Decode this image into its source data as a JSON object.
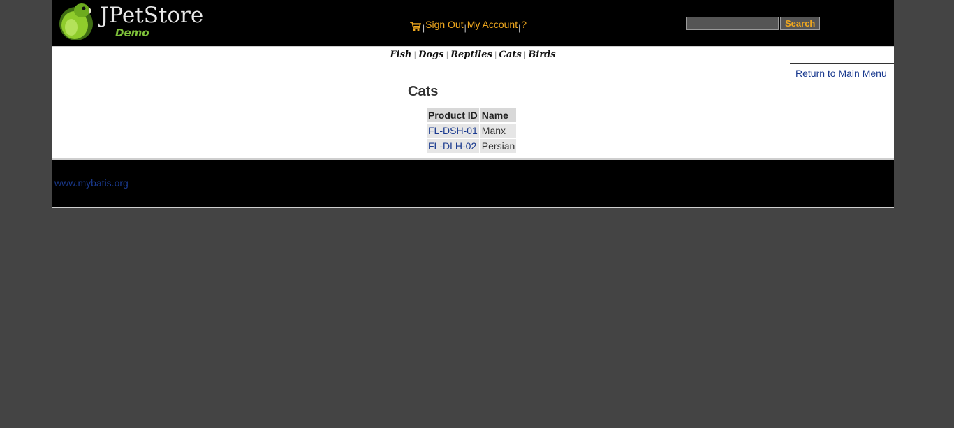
{
  "header": {
    "logo": {
      "title": "JPetStore",
      "subtitle": "Demo"
    },
    "menu": {
      "cart_icon": "shopping-cart-icon",
      "sign_out": "Sign Out",
      "my_account": "My Account",
      "help": "?",
      "separator": "|"
    },
    "search": {
      "value": "",
      "button_label": "Search"
    },
    "colors": {
      "background": "#000000",
      "link": "#f0a81e",
      "page_background": "#444444"
    }
  },
  "quicklinks": [
    "Fish",
    "Dogs",
    "Reptiles",
    "Cats",
    "Birds"
  ],
  "back_link": "Return to Main Menu",
  "category": {
    "title": "Cats",
    "columns": [
      "Product ID",
      "Name"
    ],
    "rows": [
      {
        "id": "FL-DSH-01",
        "name": "Manx"
      },
      {
        "id": "FL-DLH-02",
        "name": "Persian"
      }
    ]
  },
  "footer": {
    "link": "www.mybatis.org"
  }
}
